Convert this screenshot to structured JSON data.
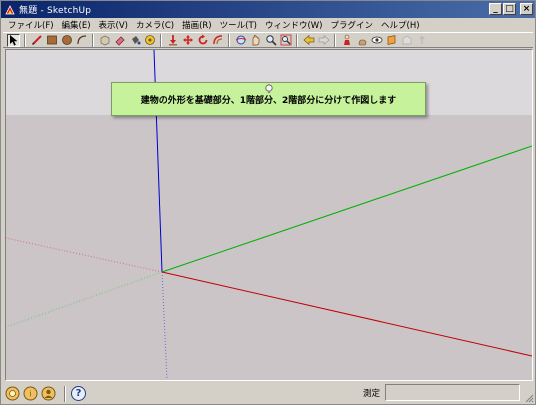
{
  "window": {
    "title": "無題 - SketchUp",
    "minimize_glyph": "_",
    "maximize_glyph": "□",
    "close_glyph": "×"
  },
  "menu": [
    "ファイル(F)",
    "編集(E)",
    "表示(V)",
    "カメラ(C)",
    "描画(R)",
    "ツール(T)",
    "ウィンドウ(W)",
    "プラグイン",
    "ヘルプ(H)"
  ],
  "toolbar": {
    "icons": [
      "select-arrow-icon",
      "pencil-line-icon",
      "rectangle-icon",
      "circle-icon",
      "arc-icon",
      "make-component-icon",
      "eraser-icon",
      "paint-bucket-icon",
      "tape-measure-icon",
      "push-pull-icon",
      "move-icon",
      "rotate-icon",
      "offset-icon",
      "orbit-icon",
      "pan-icon",
      "zoom-icon",
      "zoom-extents-icon",
      "previous-view-icon",
      "next-view-icon",
      "position-camera-icon",
      "walk-icon",
      "look-around-icon",
      "section-plane-icon",
      "get-models-icon",
      "share-model-icon"
    ]
  },
  "viewport": {
    "background_sky": "#dcd9dc",
    "background_ground": "#cbc5c8",
    "axis_colors": {
      "red": "#c00000",
      "green": "#00b000",
      "blue": "#0000d0"
    }
  },
  "tooltip": {
    "text": "建物の外形を基礎部分、1階部分、2階部分に分けて作図します",
    "background": "#c6f29b"
  },
  "status": {
    "measure_label": "測定",
    "measure_value": ""
  }
}
